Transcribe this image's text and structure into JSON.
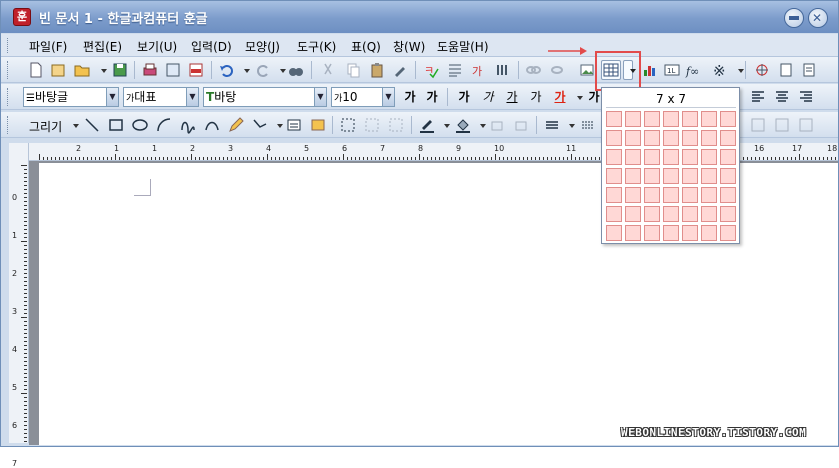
{
  "window": {
    "title": "빈 문서 1 - 한글과컴퓨터 훈글",
    "app_icon_glyph": "훈"
  },
  "menu": {
    "items": [
      "파일(F)",
      "편집(E)",
      "보기(U)",
      "입력(D)",
      "모양(J)",
      "도구(K)",
      "표(Q)",
      "창(W)",
      "도움말(H)"
    ]
  },
  "format_bar": {
    "style_value": "바탕글",
    "lang_value": "대표",
    "font_value": "바탕",
    "size_value": "10"
  },
  "draw_bar": {
    "draw_label": "그리기"
  },
  "table_dropdown": {
    "size_label": "7 x 7",
    "rows": 7,
    "cols": 7
  },
  "ruler": {
    "top_numbers": [
      "2",
      "1",
      "1",
      "2",
      "3",
      "4",
      "5",
      "6",
      "7",
      "8",
      "9",
      "10",
      "11",
      "16",
      "17",
      "18"
    ],
    "left_numbers": [
      "0",
      "1",
      "2",
      "3",
      "4",
      "5",
      "6",
      "7"
    ]
  },
  "watermark": "WEBONLINESTORY.TISTORY.COM",
  "colors": {
    "accent_red": "#e24b4b",
    "cell_fill": "#ffd8d6",
    "title_bar": "#7c9ccb"
  }
}
